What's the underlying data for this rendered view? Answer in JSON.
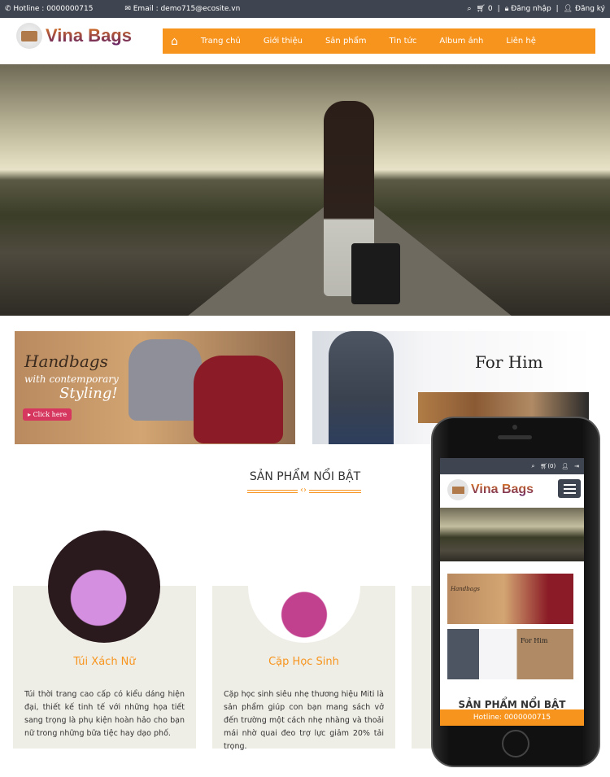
{
  "topbar": {
    "hotline": "Hotline : 0000000715",
    "email": "Email : demo715@ecosite.vn",
    "cart_count": "0",
    "login": "Đăng nhập",
    "register": "Đăng ký"
  },
  "header": {
    "logo": "Vina Bags",
    "nav": [
      "Trang chủ",
      "Giới thiệu",
      "Sản phẩm",
      "Tin tức",
      "Album ảnh",
      "Liên hệ"
    ]
  },
  "banners": {
    "left": {
      "line1": "Handbags",
      "line2": "with contemporary",
      "line3": "Styling!",
      "button": "Click here"
    },
    "right": {
      "title": "For Him"
    }
  },
  "section": {
    "title": "SẢN PHẨM NỔI BẬT"
  },
  "products": [
    {
      "name": "Túi Xách Nữ",
      "desc": "Túi thời trang cao cấp có kiểu dáng hiện đại, thiết kế tinh tế với những họa tiết sang trọng là phụ kiện hoàn hảo cho bạn nữ trong những bữa tiệc hay dạo phố."
    },
    {
      "name": "Cặp Học Sinh",
      "desc": "Cặp học sinh siêu nhẹ thương hiệu Miti là sản phẩm giúp con bạn mang sách vở đến trường một cách nhẹ nhàng và thoải mái nhờ quai đeo trợ lực giảm 20% tải trọng."
    }
  ],
  "mobile": {
    "cart": "(0)",
    "logo": "Vina Bags",
    "banner_left": "Handbags",
    "banner_right": "For Him",
    "section_title": "SẢN PHẨM NỔI BẬT",
    "hotline": "Hotline: 0000000715"
  },
  "colors": {
    "accent": "#f7941d",
    "topbar": "#3f4550",
    "card_bg": "#efeee6"
  }
}
